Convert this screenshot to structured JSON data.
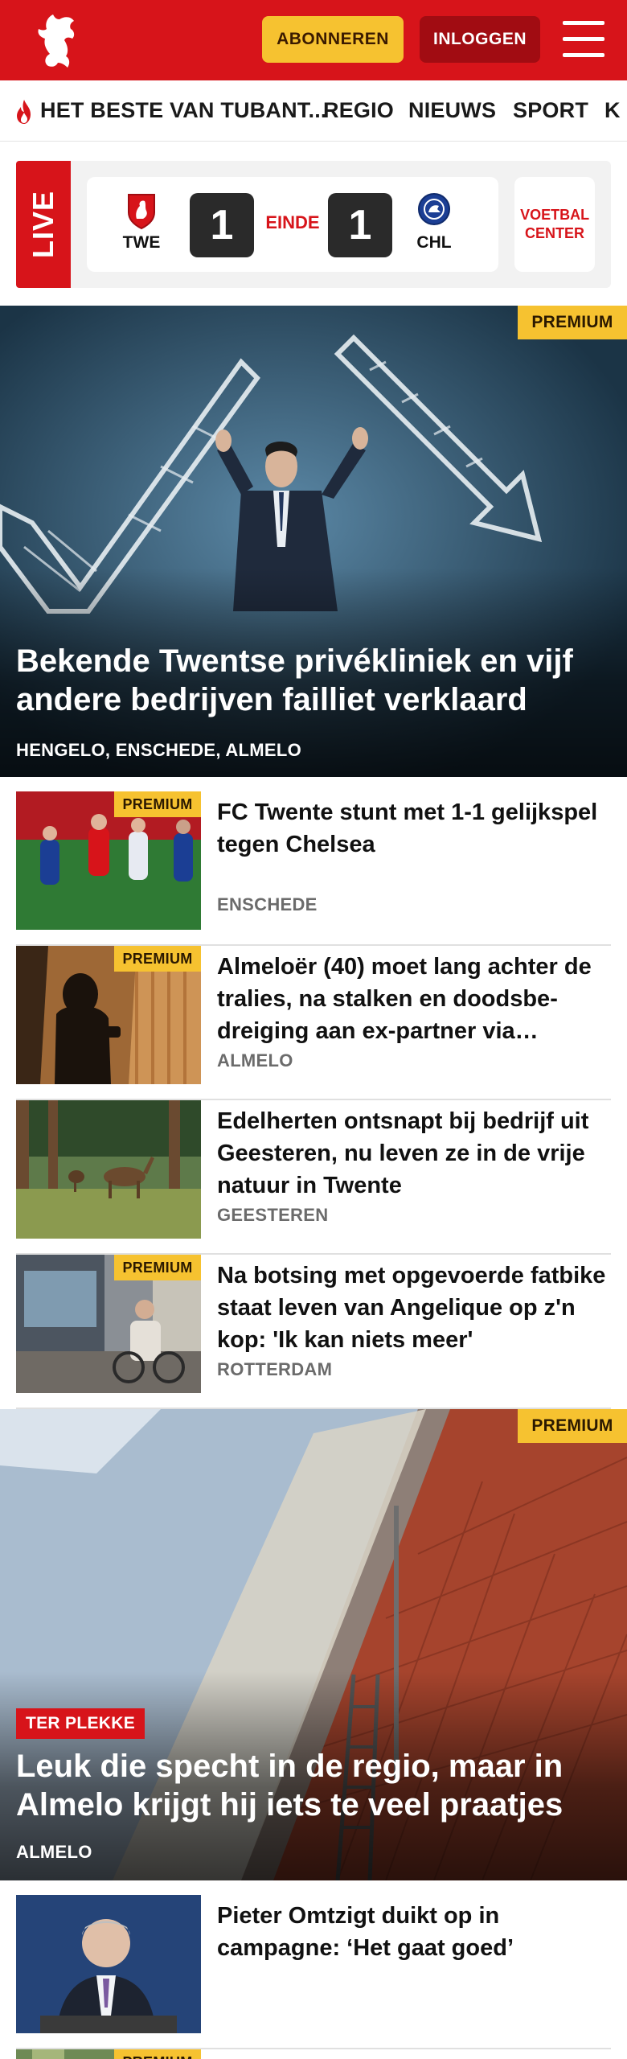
{
  "header": {
    "subscribe_label": "ABONNEREN",
    "login_label": "INLOGGEN",
    "brand_color": "#d7141a",
    "accent_color": "#f6c230"
  },
  "nav": {
    "items": [
      {
        "label": "HET BESTE VAN TUBANT..."
      },
      {
        "label": "REGIO"
      },
      {
        "label": "NIEUWS"
      },
      {
        "label": "SPORT"
      },
      {
        "label": "K"
      }
    ]
  },
  "live": {
    "label": "LIVE",
    "home_code": "TWE",
    "away_code": "CHL",
    "home_score": "1",
    "away_score": "1",
    "status": "EINDE",
    "voetbal_center": "VOETBAL CENTER"
  },
  "hero": {
    "premium": "PREMIUM",
    "title": "Bekende Twentse privékliniek en vijf andere bedrijven failliet verklaard",
    "location": "HENGELO, ENSCHEDE, ALMELO"
  },
  "articles": [
    {
      "premium": "PREMIUM",
      "title": "FC Twente stunt met 1-1 gelijkspel tegen Chelsea",
      "location": "ENSCHEDE"
    },
    {
      "premium": "PREMIUM",
      "title": "Almeloër (40) moet lang achter de tralies, na stalken en doodsbe­dreiging aan ex-partner via…",
      "location": "ALMELO"
    },
    {
      "premium": "",
      "title": "Edelherten ontsnapt bij bedrijf uit Geesteren, nu leven ze in de vrije natuur in Twente",
      "location": "GEESTEREN"
    },
    {
      "premium": "PREMIUM",
      "title": "Na botsing met opgevoerde fatbike staat leven van Angelique op z'n kop: 'Ik kan niets meer'",
      "location": "ROTTERDAM"
    }
  ],
  "hero2": {
    "premium": "PREMIUM",
    "kicker": "TER PLEKKE",
    "title": "Leuk die specht in de regio, maar in Almelo krijgt hij iets te veel praatjes",
    "location": "ALMELO"
  },
  "bottom_articles": [
    {
      "title": "Pieter Omtzigt duikt op in campagne: ‘Het gaat goed’",
      "premium": ""
    },
    {
      "title": "",
      "premium": "PREMIUM"
    }
  ]
}
